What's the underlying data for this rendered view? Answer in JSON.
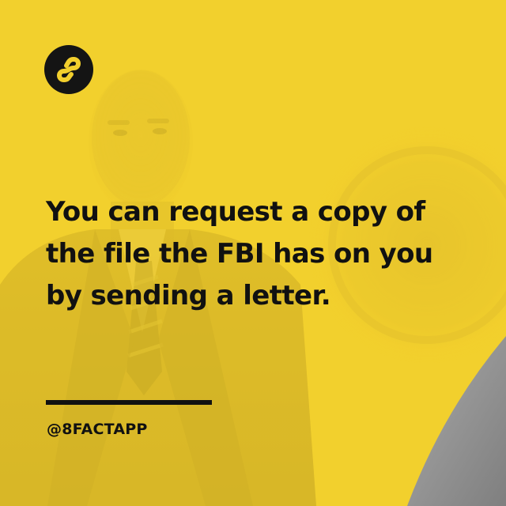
{
  "brand": {
    "logo_icon": "infinity-8-icon",
    "handle": "@8FACTAPP"
  },
  "fact": {
    "lines": [
      "You can request a copy of",
      "the file the FBI has on you",
      "by sending a letter."
    ]
  },
  "colors": {
    "background_yellow": "#f2cf2d",
    "text": "#111111",
    "logo_circle": "#141414",
    "corner_grey": "#8e8e8e"
  }
}
